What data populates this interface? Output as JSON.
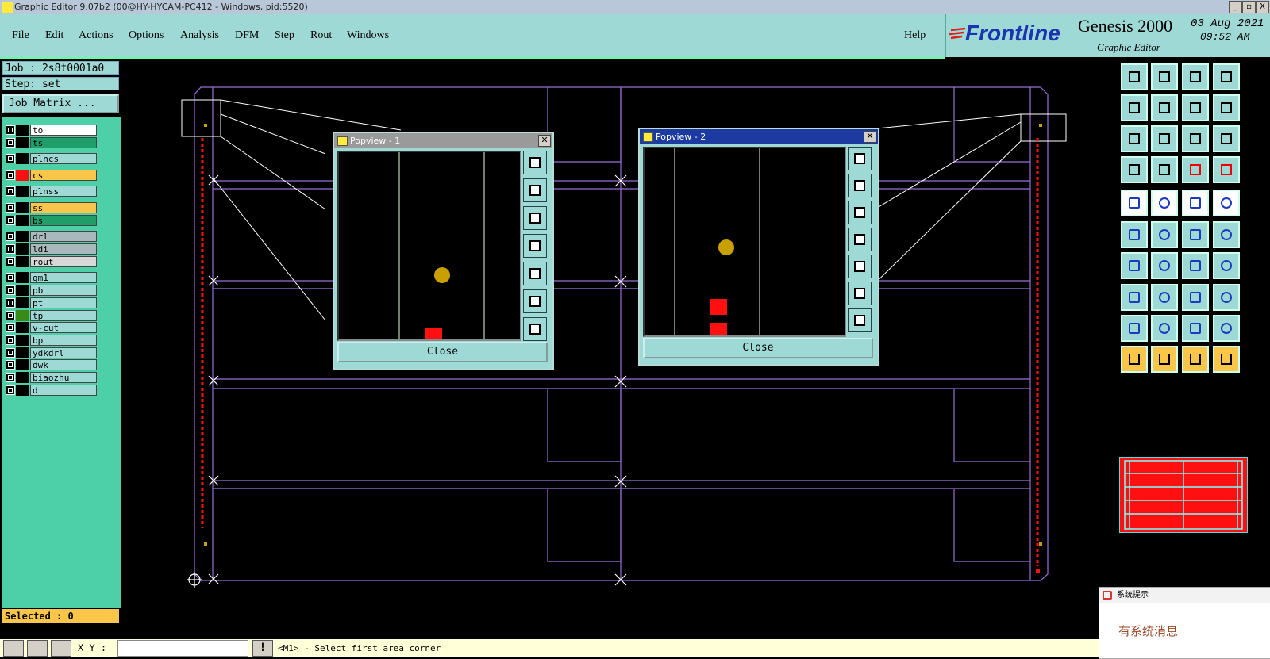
{
  "window": {
    "title": "Graphic Editor 9.07b2 (00@HY-HYCAM-PC412 - Windows, pid:5520)",
    "btn_min": "_",
    "btn_max": "▫",
    "btn_close": "X"
  },
  "menu": {
    "items": [
      "File",
      "Edit",
      "Actions",
      "Options",
      "Analysis",
      "DFM",
      "Step",
      "Rout",
      "Windows"
    ],
    "help": "Help"
  },
  "brand": {
    "logo": "Frontline",
    "product": "Genesis 2000",
    "subtitle": "Graphic Editor",
    "date": "03 Aug 2021",
    "time": "09:52 AM"
  },
  "job": {
    "job_label": "Job : 2s8t0001a0",
    "step_label": "Step: set",
    "matrix_button": "Job Matrix ..."
  },
  "layers": [
    {
      "name": "to",
      "color": "#ffffff",
      "swatch": "#000000"
    },
    {
      "name": "ts",
      "color": "#1f9e6a",
      "swatch": "#000000"
    },
    {
      "name": "plncs",
      "color": "#9fd9d6",
      "swatch": "#000000"
    },
    {
      "name": "cs",
      "color": "#f9c64a",
      "swatch": "#ff1010"
    },
    {
      "name": "plnss",
      "color": "#9fd9d6",
      "swatch": "#000000"
    },
    {
      "name": "ss",
      "color": "#f9c64a",
      "swatch": "#000000"
    },
    {
      "name": "bs",
      "color": "#1f9e6a",
      "swatch": "#000000"
    },
    {
      "name": "drl",
      "color": "#a8b8bc",
      "swatch": "#000000"
    },
    {
      "name": "ldi",
      "color": "#a8b8bc",
      "swatch": "#000000"
    },
    {
      "name": "rout",
      "color": "#d8d8d8",
      "swatch": "#000000"
    },
    {
      "name": "gm1",
      "color": "#9fd9d6",
      "swatch": "#000000"
    },
    {
      "name": "pb",
      "color": "#9fd9d6",
      "swatch": "#000000"
    },
    {
      "name": "pt",
      "color": "#9fd9d6",
      "swatch": "#000000"
    },
    {
      "name": "tp",
      "color": "#9fd9d6",
      "swatch": "#3a8a1a"
    },
    {
      "name": "v-cut",
      "color": "#9fd9d6",
      "swatch": "#000000"
    },
    {
      "name": "bp",
      "color": "#9fd9d6",
      "swatch": "#000000"
    },
    {
      "name": "ydkdrl",
      "color": "#9fd9d6",
      "swatch": "#000000"
    },
    {
      "name": "dwk",
      "color": "#9fd9d6",
      "swatch": "#000000"
    },
    {
      "name": "biaozhu",
      "color": "#9fd9d6",
      "swatch": "#000000"
    },
    {
      "name": "d",
      "color": "#9fd9d6",
      "swatch": "#000000"
    }
  ],
  "selected": "Selected : 0",
  "popview1": {
    "title": "Popview - 1",
    "close": "Close"
  },
  "popview2": {
    "title": "Popview - 2",
    "close": "Close"
  },
  "notification": {
    "title": "系统提示",
    "message": "有系统消息"
  },
  "status": {
    "xy_label": "X Y :",
    "warn": "!",
    "message": "<M1> - Select first area corner"
  },
  "colors": {
    "outline": "#9a6fd8",
    "dash_red": "#ff1010",
    "pad_gold": "#c8a000",
    "panel_cyan": "#9fd9d6",
    "layer_green": "#4dcfa8",
    "highlight_orange": "#f9c64a"
  }
}
